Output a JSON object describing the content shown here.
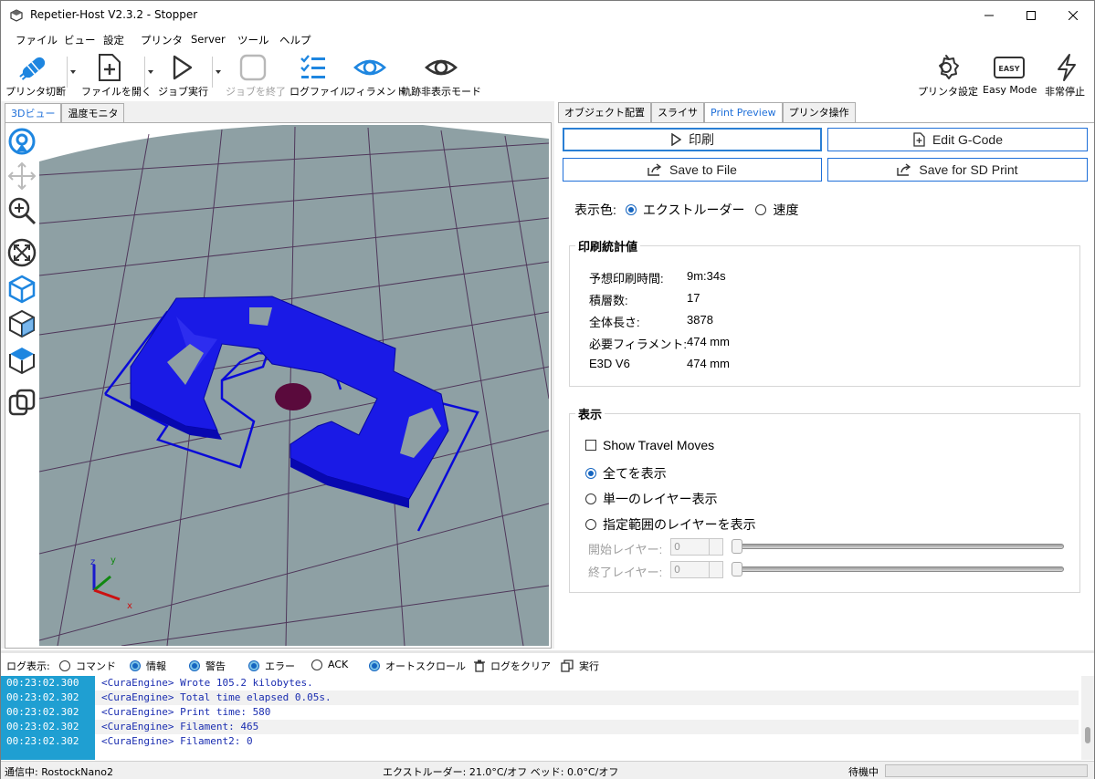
{
  "window": {
    "title": "Repetier-Host V2.3.2 - Stopper"
  },
  "menu": [
    "ファイル",
    "ビュー",
    "設定",
    "プリンタ",
    "Server",
    "ツール",
    "ヘルプ"
  ],
  "toolbar": {
    "disconnect": "プリンタ切断",
    "open_file": "ファイルを開く",
    "run_job": "ジョブ実行",
    "stop_job": "ジョブを終了",
    "log_file": "ログファイル",
    "filament": "フィラメント",
    "hide_travel": "軌跡非表示モード",
    "printer_settings": "プリンタ設定",
    "easy_mode": "Easy Mode",
    "emergency_stop": "非常停止",
    "easy_badge": "EASY"
  },
  "left_tabs": [
    "3Dビュー",
    "温度モニタ"
  ],
  "right_tabs": [
    "オブジェクト配置",
    "スライサ",
    "Print Preview",
    "プリンタ操作"
  ],
  "preview": {
    "print_button": "印刷",
    "edit_gcode_button": "Edit G-Code",
    "save_file_button": "Save to File",
    "save_sd_button": "Save for SD Print",
    "color_label": "表示色:",
    "color_extruder": "エクストルーダー",
    "color_speed": "速度",
    "stats_title": "印刷統計値",
    "stats": [
      {
        "label": "予想印刷時間:",
        "value": "9m:34s"
      },
      {
        "label": "積層数:",
        "value": "17"
      },
      {
        "label": "全体長さ:",
        "value": "3878"
      },
      {
        "label": "必要フィラメント:",
        "value": "474 mm"
      },
      {
        "label": "E3D V6",
        "value": "474 mm"
      }
    ],
    "display_title": "表示",
    "show_travel": "Show Travel Moves",
    "show_all": "全てを表示",
    "single_layer": "単一のレイヤー表示",
    "range_layer": "指定範囲のレイヤーを表示",
    "start_layer_label": "開始レイヤー:",
    "end_layer_label": "終了レイヤー:",
    "start_layer_value": "0",
    "end_layer_value": "0"
  },
  "log_bar": {
    "label": "ログ表示:",
    "command": "コマンド",
    "info": "情報",
    "warning": "警告",
    "error": "エラー",
    "ack": "ACK",
    "autoscroll": "オートスクロール",
    "clear": "ログをクリア",
    "run": "実行"
  },
  "log_entries": [
    {
      "time": "00:23:02.300",
      "msg": "<CuraEngine> Wrote 105.2 kilobytes."
    },
    {
      "time": "00:23:02.302",
      "msg": "<CuraEngine> Total time elapsed  0.05s."
    },
    {
      "time": "00:23:02.302",
      "msg": "<CuraEngine> Print time: 580"
    },
    {
      "time": "00:23:02.302",
      "msg": "<CuraEngine> Filament: 465"
    },
    {
      "time": "00:23:02.302",
      "msg": "<CuraEngine> Filament2: 0"
    }
  ],
  "status": {
    "connection": "通信中: RostockNano2",
    "temps": "エクストルーダー: 21.0°C/オフ ベッド: 0.0°C/オフ",
    "state": "待機中"
  },
  "axes": {
    "x": "x",
    "y": "y",
    "z": "z"
  },
  "colors": {
    "accent": "#1e6fd9",
    "extrusion": "#1010d8",
    "bed": "#8e9fa3",
    "log_time_bg": "#1f9fd2"
  }
}
